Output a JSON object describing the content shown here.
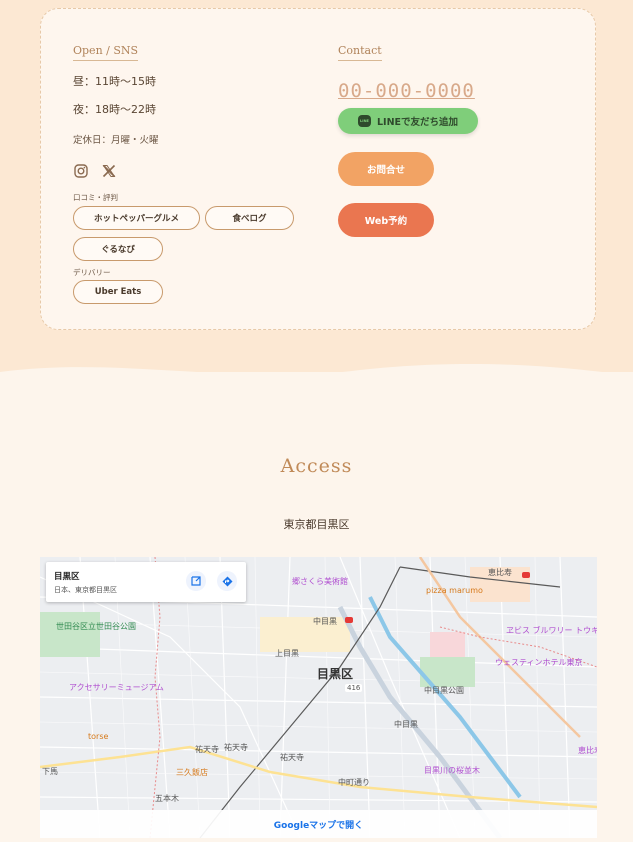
{
  "info": {
    "open_sns": {
      "heading": "Open / SNS",
      "lunch_hours": "昼：11時〜15時",
      "dinner_hours": "夜：18時〜22時",
      "holiday": "定休日：月曜・火曜",
      "reviews_label": "口コミ・評判",
      "reviews": [
        "ホットペッパーグルメ",
        "食べログ",
        "ぐるなび"
      ],
      "delivery_label": "デリバリー",
      "delivery": [
        "Uber Eats"
      ]
    },
    "contact": {
      "heading": "Contact",
      "phone": "00-000-0000",
      "line_button": "LINEで友だち追加",
      "line_icon_text": "LINE",
      "contact_button": "お問合せ",
      "web_button": "Web予約"
    }
  },
  "access": {
    "title": "Access",
    "address": "東京都目黒区"
  },
  "map": {
    "card_title": "目黒区",
    "card_subtitle": "日本、東京都目黒区",
    "open_link": "Googleマップで開く",
    "labels": {
      "meguro_ku": "目黒区",
      "nakameguro": "中目黒",
      "kamimeguro": "上目黒",
      "yutenji_area": "祐天寺",
      "yutenji_station": "祐天寺",
      "nakameguro_park": "中目黒公園",
      "nakacho": "中町通り",
      "gohongi": "五本木",
      "shimouma": "下馬",
      "setagaya_park": "世田谷区立世田谷公園",
      "ebisu": "恵比寿",
      "meguro_river": "目黒川",
      "route_416": "416",
      "nakameguro2": "中目黒"
    },
    "pois": {
      "museum": "郷さくら美術館",
      "pizza": "pizza marumo",
      "yebisu": "ヱビス ブルワリー トウキョウ",
      "westin": "ウェスティンホテル東京",
      "accessory": "アクセサリーミュージアム",
      "torse": "torse",
      "sankyu": "三久飯店",
      "sakura_trees": "目黒川の桜並木",
      "ebisu_station": "恵比寿"
    }
  }
}
